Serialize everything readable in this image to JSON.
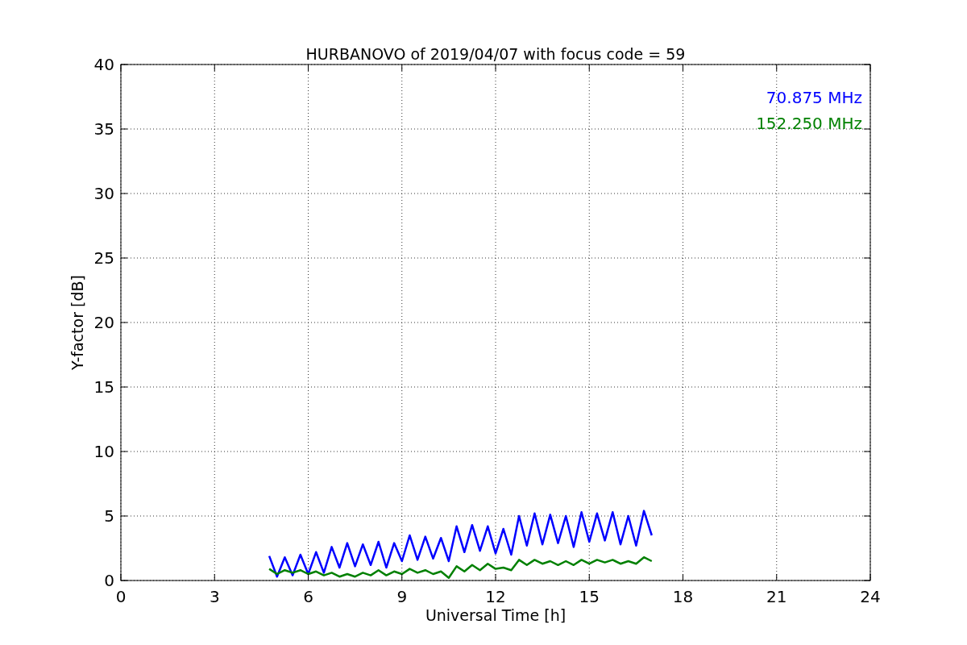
{
  "chart_data": {
    "type": "line",
    "title": "HURBANOVO of 2019/04/07 with focus code = 59",
    "xlabel": "Universal Time [h]",
    "ylabel": "Y-factor [dB]",
    "x": [
      4.75,
      5.0,
      5.25,
      5.5,
      5.75,
      6.0,
      6.25,
      6.5,
      6.75,
      7.0,
      7.25,
      7.5,
      7.75,
      8.0,
      8.25,
      8.5,
      8.75,
      9.0,
      9.25,
      9.5,
      9.75,
      10.0,
      10.25,
      10.5,
      10.75,
      11.0,
      11.25,
      11.5,
      11.75,
      12.0,
      12.25,
      12.5,
      12.75,
      13.0,
      13.25,
      13.5,
      13.75,
      14.0,
      14.25,
      14.5,
      14.75,
      15.0,
      15.25,
      15.5,
      15.75,
      16.0,
      16.25,
      16.5,
      16.75,
      17.0
    ],
    "series": [
      {
        "name": "70.875 MHz",
        "color": "#0000ff",
        "values": [
          1.9,
          0.3,
          1.8,
          0.4,
          2.0,
          0.5,
          2.2,
          0.6,
          2.6,
          1.0,
          2.9,
          1.1,
          2.8,
          1.2,
          3.0,
          1.0,
          2.9,
          1.5,
          3.5,
          1.6,
          3.4,
          1.7,
          3.3,
          1.5,
          4.2,
          2.2,
          4.3,
          2.3,
          4.2,
          2.1,
          4.0,
          2.0,
          5.0,
          2.7,
          5.2,
          2.8,
          5.1,
          2.9,
          5.0,
          2.6,
          5.3,
          3.0,
          5.2,
          3.1,
          5.3,
          2.8,
          5.0,
          2.7,
          5.4,
          3.5
        ]
      },
      {
        "name": "152.250 MHz",
        "color": "#008000",
        "values": [
          0.9,
          0.5,
          0.8,
          0.6,
          0.8,
          0.5,
          0.7,
          0.4,
          0.6,
          0.3,
          0.5,
          0.3,
          0.6,
          0.4,
          0.8,
          0.4,
          0.7,
          0.5,
          0.9,
          0.6,
          0.8,
          0.5,
          0.7,
          0.2,
          1.1,
          0.7,
          1.2,
          0.8,
          1.3,
          0.9,
          1.0,
          0.8,
          1.6,
          1.2,
          1.6,
          1.3,
          1.5,
          1.2,
          1.5,
          1.2,
          1.6,
          1.3,
          1.6,
          1.4,
          1.6,
          1.3,
          1.5,
          1.3,
          1.8,
          1.5
        ]
      }
    ],
    "grid": true,
    "xlim": [
      0,
      24
    ],
    "ylim": [
      0,
      40
    ],
    "xticks": [
      0,
      3,
      6,
      9,
      12,
      15,
      18,
      21,
      24
    ],
    "yticks": [
      0,
      5,
      10,
      15,
      20,
      25,
      30,
      35,
      40
    ]
  }
}
